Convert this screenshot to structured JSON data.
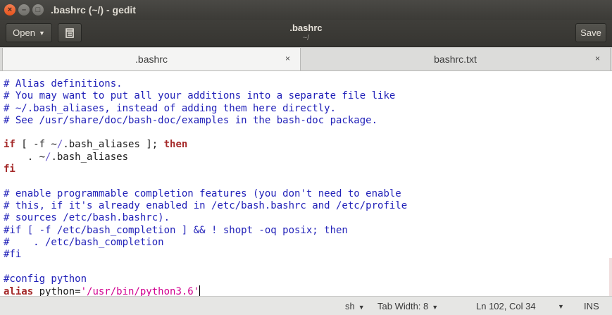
{
  "window": {
    "title": ".bashrc (~/) - gedit",
    "controls": {
      "close": "×",
      "minimize": "–",
      "maximize": "□"
    }
  },
  "header": {
    "open_label": "Open",
    "title": ".bashrc",
    "subtitle": "~/",
    "save_label": "Save",
    "icons": {
      "open_arrow": "chevron-down-icon",
      "new_document": "document-icon"
    }
  },
  "tabs": [
    {
      "label": ".bashrc",
      "close": "×",
      "active": true
    },
    {
      "label": "bashrc.txt",
      "close": "×",
      "active": false
    }
  ],
  "editor": {
    "lines": [
      [
        {
          "t": "# Alias definitions.",
          "c": "comment"
        }
      ],
      [
        {
          "t": "# You may want to put all your additions into a separate file like",
          "c": "comment"
        }
      ],
      [
        {
          "t": "# ~/.bash_aliases, instead of adding them here directly.",
          "c": "comment"
        }
      ],
      [
        {
          "t": "# See /usr/share/doc/bash-doc/examples in the bash-doc package.",
          "c": "comment"
        }
      ],
      [],
      [
        {
          "t": "if",
          "c": "kw"
        },
        {
          "t": " [ -f ~"
        },
        {
          "t": "/",
          "c": "path"
        },
        {
          "t": ".bash_aliases ]; "
        },
        {
          "t": "then",
          "c": "kw"
        }
      ],
      [
        {
          "t": "    . ~"
        },
        {
          "t": "/",
          "c": "path"
        },
        {
          "t": ".bash_aliases"
        }
      ],
      [
        {
          "t": "fi",
          "c": "kw"
        }
      ],
      [],
      [
        {
          "t": "# enable programmable completion features (you don't need to enable",
          "c": "comment"
        }
      ],
      [
        {
          "t": "# this, if it's already enabled in /etc/bash.bashrc and /etc/profile",
          "c": "comment"
        }
      ],
      [
        {
          "t": "# sources /etc/bash.bashrc).",
          "c": "comment"
        }
      ],
      [
        {
          "t": "#if [ -f /etc/bash_completion ] && ! shopt -oq posix; then",
          "c": "comment"
        }
      ],
      [
        {
          "t": "#    . /etc/bash_completion",
          "c": "comment"
        }
      ],
      [
        {
          "t": "#fi",
          "c": "comment"
        }
      ],
      [],
      [
        {
          "t": "#config python",
          "c": "comment"
        }
      ],
      [
        {
          "t": "alias",
          "c": "kw"
        },
        {
          "t": " python="
        },
        {
          "t": "'/usr/bin/python3.6'",
          "c": "str"
        }
      ]
    ]
  },
  "statusbar": {
    "language": "sh",
    "tab_width": "Tab Width: 8",
    "position": "Ln 102, Col 34",
    "mode": "INS"
  }
}
